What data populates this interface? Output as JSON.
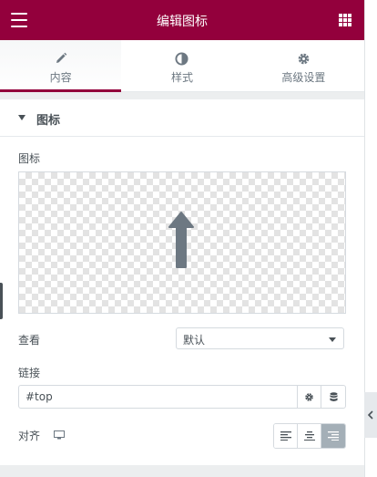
{
  "header": {
    "title": "编辑图标",
    "menu_icon": "hamburger-icon",
    "widgets_icon": "grid-icon",
    "accent_color": "#93003c"
  },
  "tabs": [
    {
      "label": "内容",
      "icon": "pencil-icon",
      "active": true
    },
    {
      "label": "样式",
      "icon": "half-circle-icon",
      "active": false
    },
    {
      "label": "高级设置",
      "icon": "gear-icon",
      "active": false
    }
  ],
  "section": {
    "title": "图标",
    "expanded": true
  },
  "fields": {
    "icon_label": "图标",
    "icon_preview": "arrow-up-icon",
    "view_label": "查看",
    "view_value": "默认",
    "link_label": "链接",
    "link_value": "#top",
    "align_label": "对齐",
    "align_options": [
      "left",
      "center",
      "right"
    ],
    "align_selected": "right"
  }
}
